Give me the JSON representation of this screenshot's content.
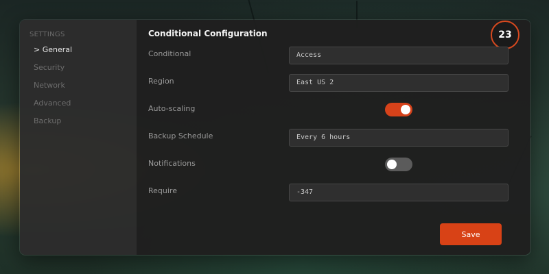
{
  "sidebar": {
    "heading": "SETTINGS",
    "items": [
      {
        "label": "> General"
      },
      {
        "label": "Security"
      },
      {
        "label": "Network"
      },
      {
        "label": "Advanced"
      },
      {
        "label": "Backup"
      }
    ]
  },
  "main": {
    "title": "Conditional Configuration",
    "badge": "23",
    "fields": [
      {
        "label": "Conditional",
        "value": "Access"
      },
      {
        "label": "Region",
        "value": "East US 2"
      },
      {
        "label": "Auto-scaling",
        "toggle": true
      },
      {
        "label": "Backup Schedule",
        "value": "Every 6 hours"
      },
      {
        "label": "Notifications",
        "toggle": false
      },
      {
        "label": "Require",
        "value": "-347"
      }
    ],
    "save_label": "Save"
  },
  "colors": {
    "accent": "#d84216",
    "toggle_off": "#5b5b5b"
  }
}
